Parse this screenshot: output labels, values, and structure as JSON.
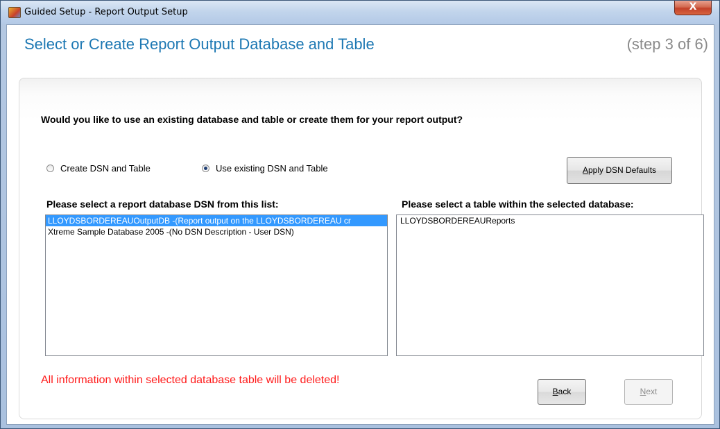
{
  "window": {
    "title": "Guided Setup - Report Output Setup",
    "close_label": "X"
  },
  "header": {
    "title": "Select or Create Report Output Database and Table",
    "step": "(step 3 of 6)"
  },
  "question": "Would you like to use an existing database and table or create them for your report output?",
  "radios": {
    "create_label": "Create DSN and Table",
    "existing_label": "Use existing DSN and Table",
    "selected": "existing"
  },
  "buttons": {
    "apply_dsn_defaults": "Apply DSN Defaults",
    "back": "Back",
    "next": "Next"
  },
  "dsn_list": {
    "label": "Please select a report database DSN from this list:",
    "items": [
      "LLOYDSBORDEREAUOutputDB -(Report output on the LLOYDSBORDEREAU cr",
      "Xtreme Sample Database 2005 -(No DSN Description - User DSN)"
    ],
    "selected_index": 0
  },
  "table_list": {
    "label": "Please select a table within the selected database:",
    "items": [
      "LLOYDSBORDEREAUReports"
    ]
  },
  "warning": "All information within selected database table will be deleted!",
  "colors": {
    "heading": "#1d78b3",
    "warning": "#ff1a1a",
    "selection": "#3399ff"
  }
}
